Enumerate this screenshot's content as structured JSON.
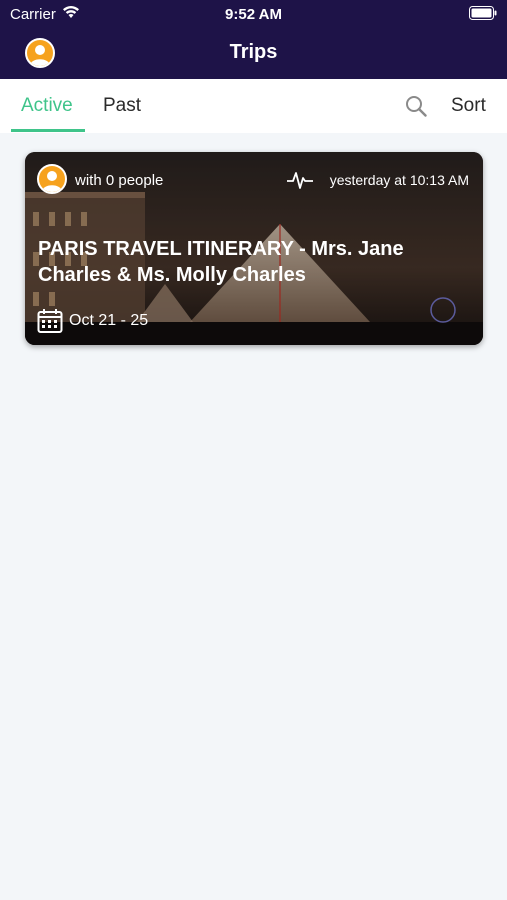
{
  "status_bar": {
    "carrier": "Carrier",
    "time": "9:52 AM"
  },
  "nav": {
    "title": "Trips",
    "avatar": "user-avatar"
  },
  "tabs": {
    "active_label": "Active",
    "past_label": "Past",
    "sort_label": "Sort",
    "search_icon": "search-icon"
  },
  "colors": {
    "header": "#1e1348",
    "accent": "#3fc48a",
    "avatar": "#f6a21e",
    "background": "#f3f6f9"
  },
  "trips": [
    {
      "people": "with 0 people",
      "updated": "yesterday at 10:13 AM",
      "title": "PARIS TRAVEL ITINERARY - Mrs. Jane Charles & Ms. Molly Charles",
      "dates": "Oct 21 - 25"
    }
  ]
}
